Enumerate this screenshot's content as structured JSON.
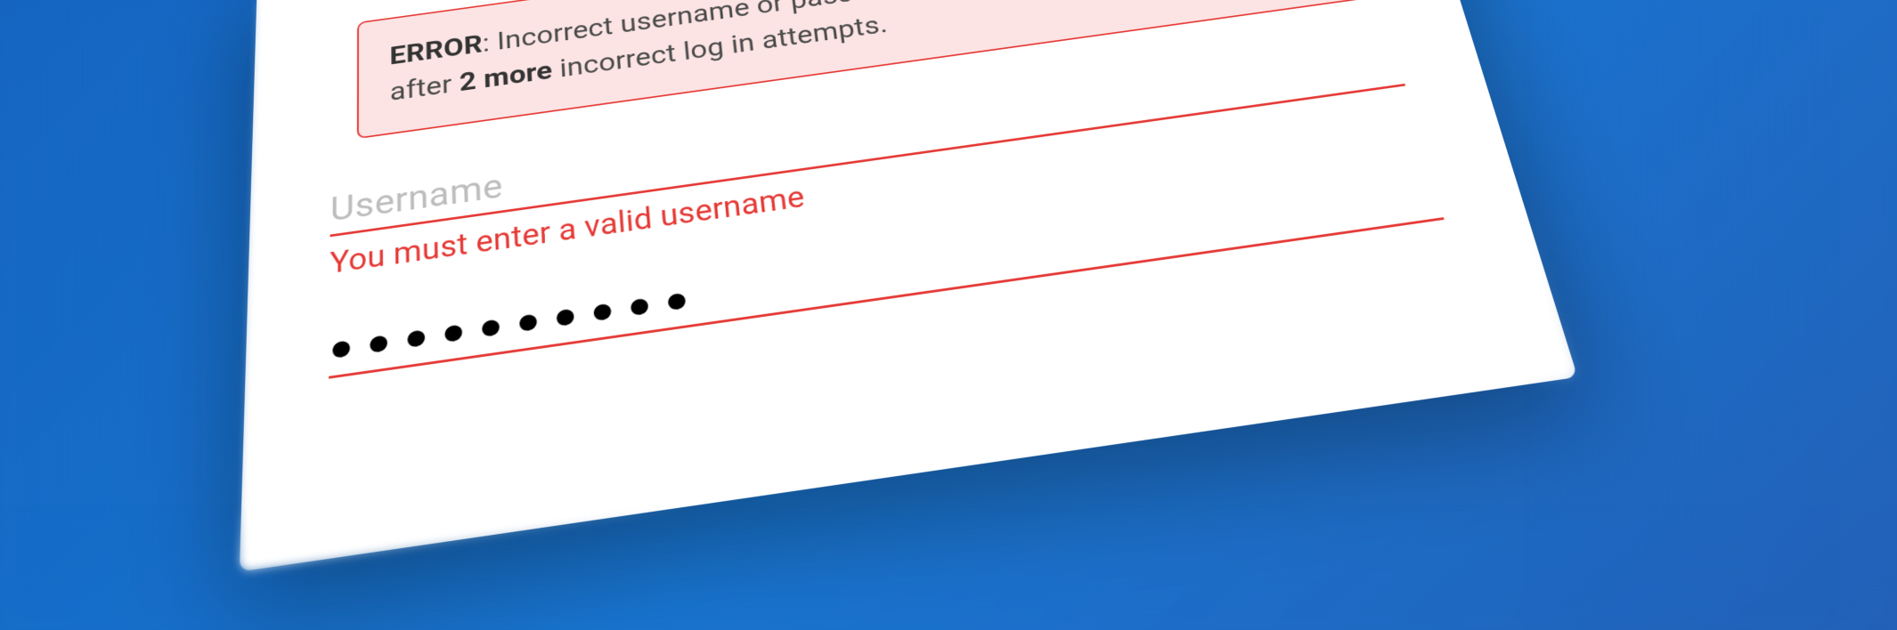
{
  "error": {
    "prefix": "ERROR",
    "message_part1": ": Incorrect username or password. This account will be locked after ",
    "emphasis": "2 more",
    "message_part2": " incorrect log in attempts."
  },
  "username": {
    "placeholder": "Username",
    "value": "",
    "validation": "You must enter a valid username"
  },
  "password": {
    "mask": "●●●●●●●●●●"
  },
  "colors": {
    "background": "#1976D2",
    "error_border": "#E53935",
    "error_fill": "#FCE4E4",
    "placeholder": "#bdbdbd"
  }
}
